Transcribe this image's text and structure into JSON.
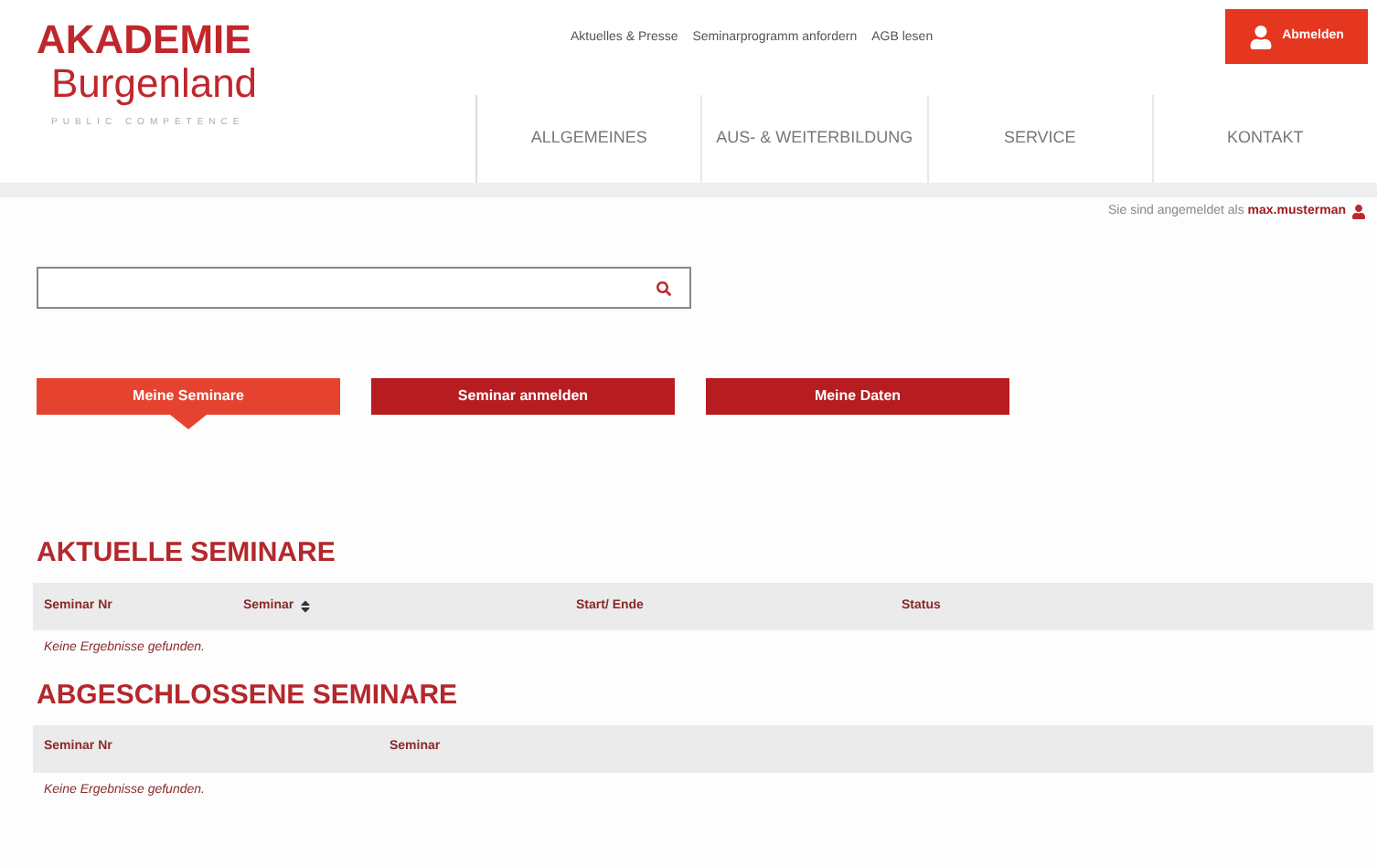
{
  "logo": {
    "line_1": "AKADEMIE",
    "line_2": "Burgenland",
    "tagline": "PUBLIC COMPETENCE"
  },
  "top_links": [
    "Aktuelles & Presse",
    "Seminarprogramm anfordern",
    "AGB lesen"
  ],
  "logout_button": "Abmelden",
  "nav": [
    "ALLGEMEINES",
    "AUS- & WEITERBILDUNG",
    "SERVICE",
    "KONTAKT"
  ],
  "login_status": {
    "text": "Sie sind angemeldet als",
    "user": "max.musterman"
  },
  "tabs": [
    {
      "label": "Meine Seminare",
      "selected": true
    },
    {
      "label": "Seminar anmelden",
      "selected": false
    },
    {
      "label": "Meine Daten",
      "selected": false
    }
  ],
  "sections": [
    {
      "title": "AKTUELLE SEMINARE",
      "columns": [
        {
          "label": "Seminar Nr",
          "sortable": false
        },
        {
          "label": "Seminar",
          "sortable": true
        },
        {
          "label": "Start/ Ende",
          "sortable": false
        },
        {
          "label": "Status",
          "sortable": false
        }
      ],
      "empty_message": "Keine Ergebnisse gefunden."
    },
    {
      "title": "ABGESCHLOSSENE SEMINARE",
      "columns": [
        {
          "label": "Seminar Nr",
          "sortable": false
        },
        {
          "label": "Seminar",
          "sortable": false
        }
      ],
      "empty_message": "Keine Ergebnisse gefunden."
    }
  ]
}
